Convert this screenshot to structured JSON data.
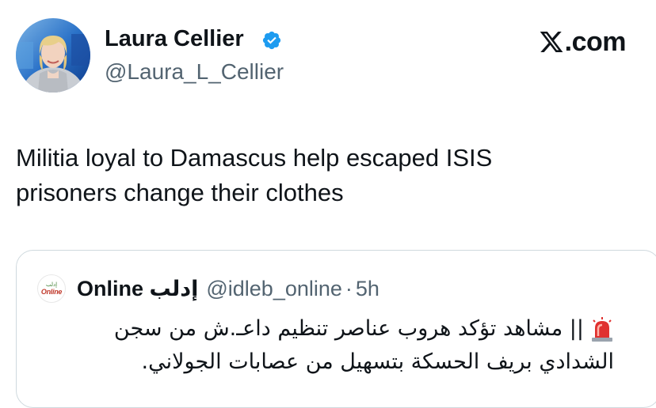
{
  "author": {
    "name": "Laura Cellier",
    "handle": "@Laura_L_Cellier",
    "verified": true
  },
  "brand": {
    "suffix": ".com",
    "icon": "x-logo-icon"
  },
  "tweet": {
    "line1": "Militia loyal to Damascus help escaped ISIS",
    "line2": "prisoners change their clothes"
  },
  "quoted": {
    "avatar_text_top": "إدلب",
    "avatar_text_bottom": "Online",
    "name": "Online إدلب",
    "handle": "@idleb_online",
    "separator": "·",
    "time": "5h",
    "siren_icon": "siren-icon",
    "line1": "|| مشاهد تؤكد هروب عناصر تنظيم داعـ.ش من سجن",
    "line2": "الشدادي بريف الحسكة بتسهيل من عصابات الجولاني."
  },
  "colors": {
    "verified": "#1d9bf0",
    "secondary_text": "#536471",
    "border": "#cfd9de"
  }
}
